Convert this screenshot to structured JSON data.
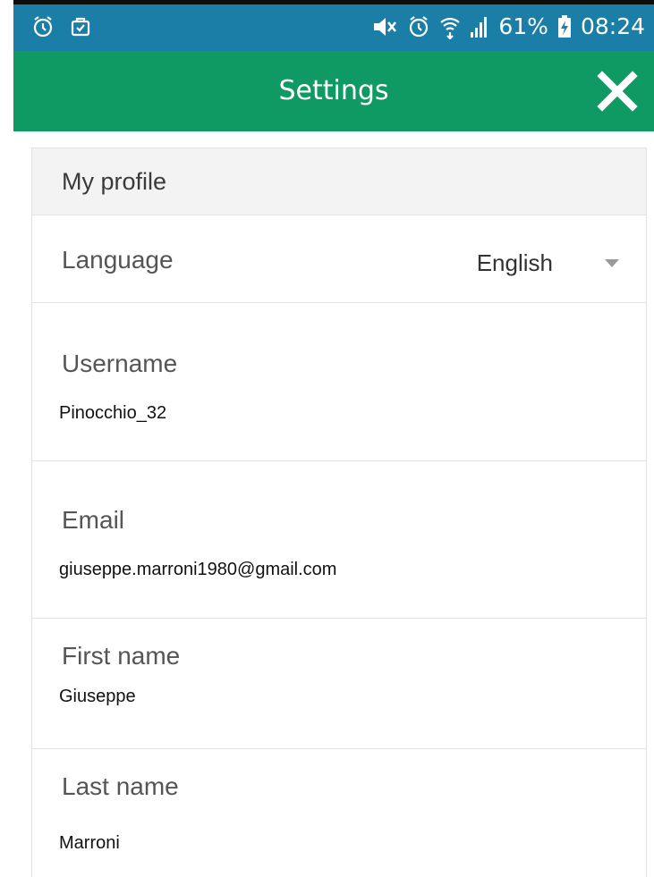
{
  "status_bar": {
    "battery_percent": "61%",
    "time": "08:24",
    "icons": [
      "alarm-icon",
      "clipboard-check-icon",
      "mute-icon",
      "alarm-icon",
      "wifi-icon",
      "signal-icon",
      "battery-charging-icon"
    ]
  },
  "app_bar": {
    "title": "Settings",
    "close_icon": "close-icon",
    "color": "#0e9a62"
  },
  "profile": {
    "section_title": "My profile",
    "language": {
      "label": "Language",
      "value": "English"
    },
    "username": {
      "label": "Username",
      "value": "Pinocchio_32"
    },
    "email": {
      "label": "Email",
      "value": "giuseppe.marroni1980@gmail.com"
    },
    "first_name": {
      "label": "First name",
      "value": "Giuseppe"
    },
    "last_name": {
      "label": "Last name",
      "value": "Marroni"
    }
  },
  "colors": {
    "status_bar": "#1b7ea6",
    "app_bar": "#0e9a62"
  }
}
